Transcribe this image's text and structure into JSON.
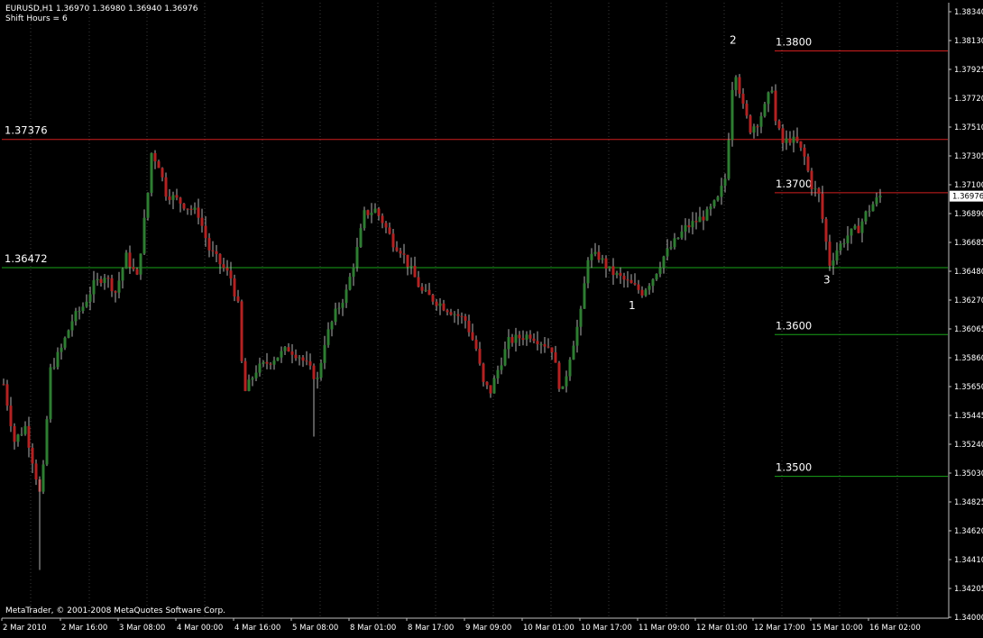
{
  "header": {
    "symbol_line": "EURUSD,H1  1.36970 1.36980 1.36940 1.36976",
    "shift_line": "Shift Hours = 6"
  },
  "footer": {
    "copyright": "MetaTrader, © 2001-2008 MetaQuotes Software Corp."
  },
  "colors": {
    "background": "#000000",
    "axis": "#c0c0c0",
    "grid": "#3a3a3a",
    "bull": "#2e7d32",
    "bear": "#b22222",
    "wick": "#b0b0b0",
    "resistance": "#d01f1f",
    "support": "#19a319"
  },
  "chart_data": {
    "type": "candlestick",
    "symbol": "EURUSD",
    "timeframe": "H1",
    "ylim": [
      1.34,
      1.3834
    ],
    "grid": true,
    "y_ticks": [
      "1.38340",
      "1.38130",
      "1.37925",
      "1.37720",
      "1.37510",
      "1.37305",
      "1.37100",
      "1.36890",
      "1.36685",
      "1.36480",
      "1.36270",
      "1.36065",
      "1.35860",
      "1.35650",
      "1.35445",
      "1.35240",
      "1.35030",
      "1.34825",
      "1.34620",
      "1.34410",
      "1.34205",
      "1.34000"
    ],
    "x_ticks": [
      "2 Mar 2010",
      "2 Mar 16:00",
      "3 Mar 08:00",
      "4 Mar 00:00",
      "4 Mar 16:00",
      "5 Mar 08:00",
      "8 Mar 01:00",
      "8 Mar 17:00",
      "9 Mar 09:00",
      "10 Mar 01:00",
      "10 Mar 17:00",
      "11 Mar 09:00",
      "12 Mar 01:00",
      "12 Mar 17:00",
      "15 Mar 10:00",
      "16 Mar 02:00"
    ],
    "current_price": "1.36976",
    "current_price_value": 1.36976,
    "price_path": [
      [
        0,
        1.3565
      ],
      [
        3,
        1.3525
      ],
      [
        6,
        1.3535
      ],
      [
        9,
        1.35
      ],
      [
        10,
        1.3488
      ],
      [
        11,
        1.3505
      ],
      [
        13,
        1.3575
      ],
      [
        16,
        1.359
      ],
      [
        19,
        1.361
      ],
      [
        22,
        1.362
      ],
      [
        25,
        1.3635
      ],
      [
        28,
        1.3642
      ],
      [
        31,
        1.363
      ],
      [
        34,
        1.3655
      ],
      [
        37,
        1.364
      ],
      [
        40,
        1.37
      ],
      [
        41,
        1.3728
      ],
      [
        43,
        1.372
      ],
      [
        45,
        1.37
      ],
      [
        48,
        1.3695
      ],
      [
        51,
        1.369
      ],
      [
        54,
        1.3685
      ],
      [
        57,
        1.366
      ],
      [
        60,
        1.365
      ],
      [
        63,
        1.364
      ],
      [
        65,
        1.362
      ],
      [
        66,
        1.358
      ],
      [
        67,
        1.356
      ],
      [
        70,
        1.3575
      ],
      [
        73,
        1.358
      ],
      [
        76,
        1.3585
      ],
      [
        79,
        1.359
      ],
      [
        82,
        1.3585
      ],
      [
        85,
        1.3575
      ],
      [
        87,
        1.3568
      ],
      [
        89,
        1.3595
      ],
      [
        92,
        1.3615
      ],
      [
        95,
        1.363
      ],
      [
        98,
        1.366
      ],
      [
        100,
        1.3685
      ],
      [
        103,
        1.3688
      ],
      [
        105,
        1.368
      ],
      [
        108,
        1.3665
      ],
      [
        110,
        1.366
      ],
      [
        113,
        1.3645
      ],
      [
        116,
        1.363
      ],
      [
        119,
        1.3625
      ],
      [
        122,
        1.362
      ],
      [
        125,
        1.3615
      ],
      [
        128,
        1.361
      ],
      [
        131,
        1.359
      ],
      [
        133,
        1.3565
      ],
      [
        135,
        1.356
      ],
      [
        137,
        1.3575
      ],
      [
        140,
        1.3595
      ],
      [
        143,
        1.3598
      ],
      [
        146,
        1.36
      ],
      [
        149,
        1.3595
      ],
      [
        152,
        1.359
      ],
      [
        154,
        1.3565
      ],
      [
        155,
        1.356
      ],
      [
        157,
        1.3585
      ],
      [
        160,
        1.3615
      ],
      [
        162,
        1.3655
      ],
      [
        165,
        1.3655
      ],
      [
        168,
        1.3645
      ],
      [
        171,
        1.364
      ],
      [
        174,
        1.3635
      ],
      [
        177,
        1.363
      ],
      [
        180,
        1.364
      ],
      [
        183,
        1.3655
      ],
      [
        186,
        1.3665
      ],
      [
        189,
        1.3675
      ],
      [
        192,
        1.368
      ],
      [
        195,
        1.3685
      ],
      [
        198,
        1.3695
      ],
      [
        200,
        1.371
      ],
      [
        201,
        1.374
      ],
      [
        202,
        1.3775
      ],
      [
        203,
        1.3785
      ],
      [
        205,
        1.376
      ],
      [
        207,
        1.3745
      ],
      [
        209,
        1.375
      ],
      [
        211,
        1.376
      ],
      [
        213,
        1.3775
      ],
      [
        214,
        1.375
      ],
      [
        216,
        1.3735
      ],
      [
        218,
        1.3738
      ],
      [
        220,
        1.3735
      ],
      [
        222,
        1.3725
      ],
      [
        224,
        1.3705
      ],
      [
        226,
        1.3698
      ],
      [
        228,
        1.3665
      ],
      [
        229,
        1.365
      ],
      [
        231,
        1.366
      ],
      [
        234,
        1.367
      ],
      [
        237,
        1.3675
      ],
      [
        239,
        1.3685
      ],
      [
        241,
        1.3692
      ],
      [
        243,
        1.36976
      ]
    ],
    "levels": [
      {
        "label": "1.37376",
        "value": 1.37376,
        "color": "resistance",
        "span": "full",
        "label_side": "left"
      },
      {
        "label": "1.36472",
        "value": 1.36472,
        "color": "support",
        "span": "full",
        "label_side": "left"
      },
      {
        "label": "1.3800",
        "value": 1.38,
        "color": "resistance",
        "span": "right"
      },
      {
        "label": "1.3700",
        "value": 1.37,
        "color": "resistance",
        "span": "right"
      },
      {
        "label": "1.3600",
        "value": 1.36,
        "color": "support",
        "span": "right"
      },
      {
        "label": "1.3500",
        "value": 1.35,
        "color": "support",
        "span": "right"
      }
    ],
    "annotations": [
      {
        "text": "1",
        "bar": 174,
        "value": 1.3618
      },
      {
        "text": "2",
        "bar": 202,
        "value": 1.3805
      },
      {
        "text": "3",
        "bar": 228,
        "value": 1.3636
      }
    ]
  }
}
